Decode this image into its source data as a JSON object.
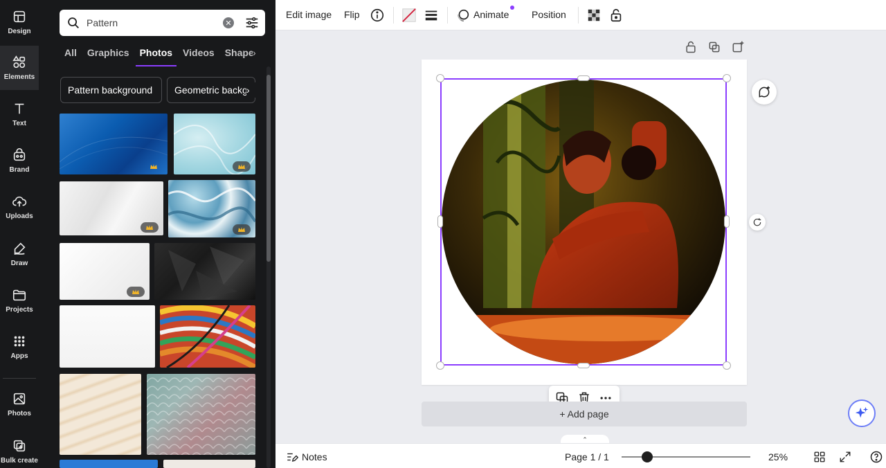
{
  "rail": {
    "items": [
      {
        "label": "Design",
        "icon": "design-icon"
      },
      {
        "label": "Elements",
        "icon": "elements-icon"
      },
      {
        "label": "Text",
        "icon": "text-icon"
      },
      {
        "label": "Brand",
        "icon": "brand-icon"
      },
      {
        "label": "Uploads",
        "icon": "uploads-icon"
      },
      {
        "label": "Draw",
        "icon": "draw-icon"
      },
      {
        "label": "Projects",
        "icon": "projects-icon"
      },
      {
        "label": "Apps",
        "icon": "apps-icon"
      },
      {
        "label": "Photos",
        "icon": "photos-icon"
      },
      {
        "label": "Bulk create",
        "icon": "bulk-create-icon"
      }
    ]
  },
  "panel": {
    "search_value": "Pattern",
    "tabs": [
      "All",
      "Graphics",
      "Photos",
      "Videos",
      "Shapes"
    ],
    "active_tab": "Photos",
    "chips": [
      "Pattern background",
      "Geometric background"
    ]
  },
  "toolbar": {
    "edit_image": "Edit image",
    "flip": "Flip",
    "animate": "Animate",
    "position": "Position"
  },
  "canvas": {
    "add_page": "+ Add page"
  },
  "bottom": {
    "notes": "Notes",
    "page_indicator": "Page 1 / 1",
    "zoom": "25%",
    "zoom_level": 0.2
  },
  "colors": {
    "accent": "#8b3dff",
    "rail_bg": "#18191b",
    "canvas_bg": "#ebecf0"
  }
}
